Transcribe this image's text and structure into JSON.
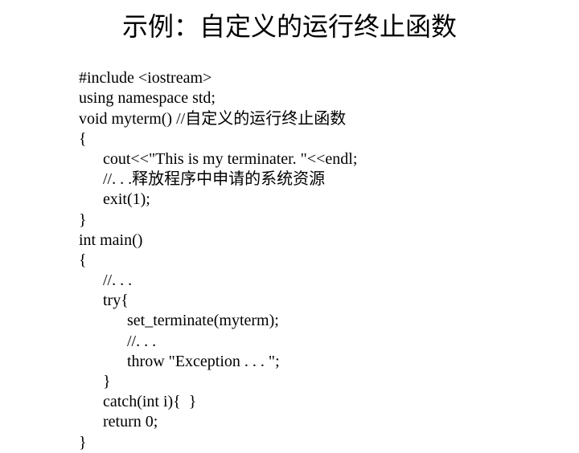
{
  "title": "示例：自定义的运行终止函数",
  "code": {
    "l01": "#include <iostream>",
    "l02": "using namespace std;",
    "l03": "void myterm() //自定义的运行终止函数",
    "l04": "{",
    "l05": "      cout<<\"This is my terminater. \"<<endl;",
    "l06": "      //. . .释放程序中申请的系统资源",
    "l07": "      exit(1);",
    "l08": "}",
    "l09": "int main()",
    "l10": "{",
    "l11": "      //. . .",
    "l12": "      try{",
    "l13": "            set_terminate(myterm);",
    "l14": "            //. . .",
    "l15": "            throw \"Exception . . . \";",
    "l16": "      }",
    "l17": "      catch(int i){  }",
    "l18": "      return 0;",
    "l19": "}"
  }
}
